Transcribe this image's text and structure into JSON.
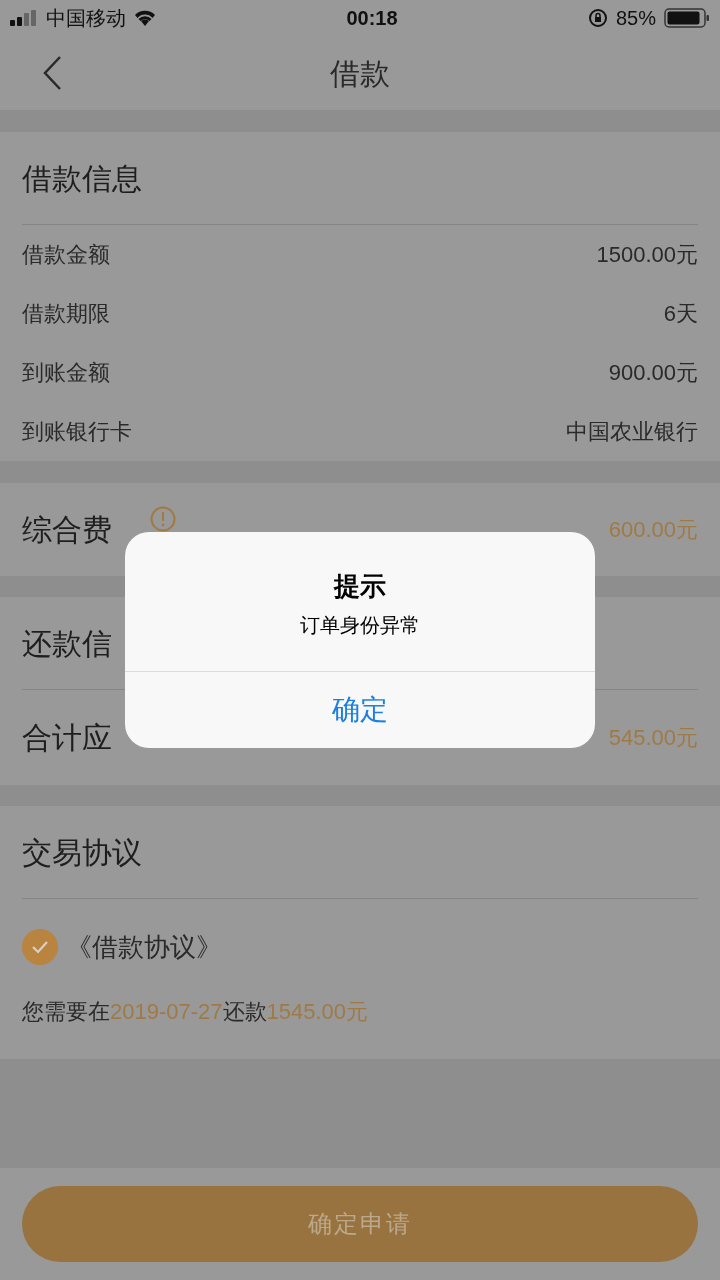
{
  "status_bar": {
    "carrier": "中国移动",
    "time": "00:18",
    "battery": "85%"
  },
  "nav": {
    "title": "借款"
  },
  "loan_info": {
    "title": "借款信息",
    "rows": [
      {
        "label": "借款金额",
        "value": "1500.00元"
      },
      {
        "label": "借款期限",
        "value": "6天"
      },
      {
        "label": "到账金额",
        "value": "900.00元"
      },
      {
        "label": "到账银行卡",
        "value": "中国农业银行"
      }
    ]
  },
  "fees": {
    "label": "综合费",
    "value": "600.00元"
  },
  "repay_info": {
    "title": "还款信",
    "total_label": "合计应",
    "total_value": "545.00元"
  },
  "agreement": {
    "title": "交易协议",
    "checkbox": {
      "label": "《借款协议》",
      "checked": true
    },
    "note": [
      {
        "text": "您需要在",
        "highlight": false
      },
      {
        "text": "2019-07-27",
        "highlight": true
      },
      {
        "text": "还款",
        "highlight": false
      },
      {
        "text": "1545.00元",
        "highlight": true
      }
    ]
  },
  "submit_button": "确定申请",
  "dialog": {
    "title": "提示",
    "message": "订单身份异常",
    "button": "确定"
  }
}
